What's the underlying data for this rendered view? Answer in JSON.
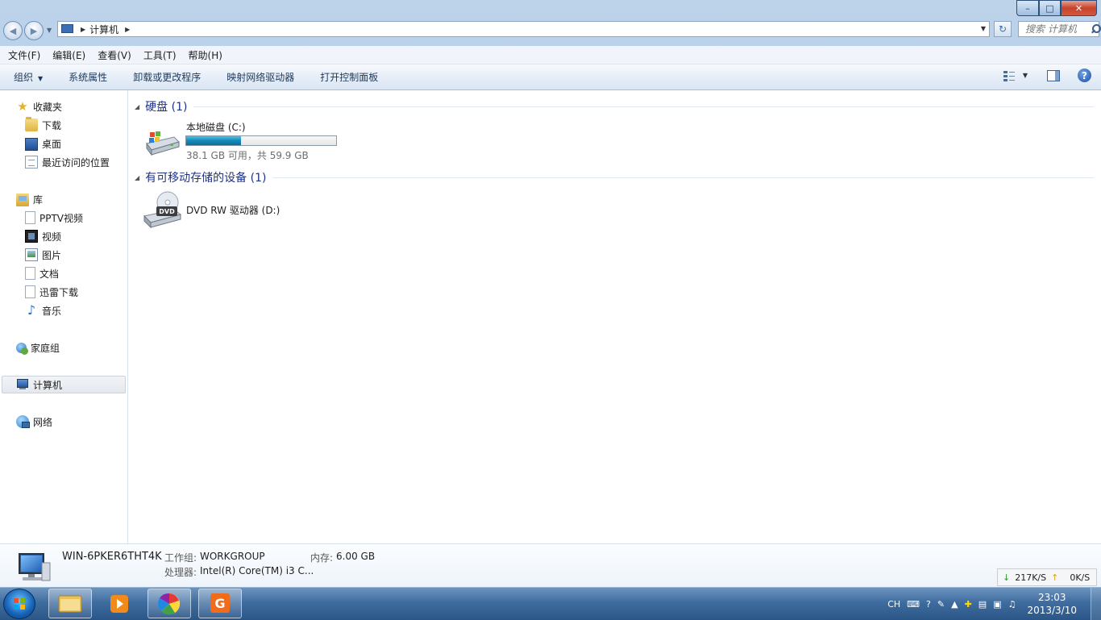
{
  "window": {
    "caption": {
      "minimize": "–",
      "maximize": "□",
      "close": "✕"
    }
  },
  "address": {
    "location": "计算机",
    "search_placeholder": "搜索 计算机"
  },
  "menubar": [
    "文件(F)",
    "编辑(E)",
    "查看(V)",
    "工具(T)",
    "帮助(H)"
  ],
  "command_bar": {
    "organize": "组织",
    "items": [
      "系统属性",
      "卸载或更改程序",
      "映射网络驱动器",
      "打开控制面板"
    ]
  },
  "nav_pane": {
    "favorites": {
      "label": "收藏夹",
      "items": [
        "下载",
        "桌面",
        "最近访问的位置"
      ]
    },
    "libraries": {
      "label": "库",
      "items": [
        "PPTV视频",
        "视频",
        "图片",
        "文档",
        "迅雷下载",
        "音乐"
      ]
    },
    "homegroup": "家庭组",
    "computer": "计算机",
    "network": "网络"
  },
  "content": {
    "hard_disks": {
      "header": "硬盘 (1)",
      "drive": {
        "name": "本地磁盘 (C:)",
        "space": "38.1 GB 可用，共 59.9 GB",
        "used_fraction": 0.364
      }
    },
    "removable": {
      "header": "有可移动存储的设备 (1)",
      "drive": {
        "name": "DVD RW 驱动器 (D:)",
        "icon_label": "DVD"
      }
    }
  },
  "details": {
    "computer_name": "WIN-6PKER6THT4K",
    "workgroup_label": "工作组:",
    "workgroup": "WORKGROUP",
    "memory_label": "内存:",
    "memory": "6.00 GB",
    "processor_label": "处理器:",
    "processor": "Intel(R) Core(TM) i3 C..."
  },
  "net_speed": {
    "down": "217K/S",
    "up": "0K/S"
  },
  "taskbar": {
    "tray": {
      "lang": "CH"
    },
    "clock": {
      "time": "23:03",
      "date": "2013/3/10"
    }
  },
  "colors": {
    "group_header": "#1e3287",
    "progress": "#1a8dbb",
    "taskbar": "#3f6d9f"
  }
}
